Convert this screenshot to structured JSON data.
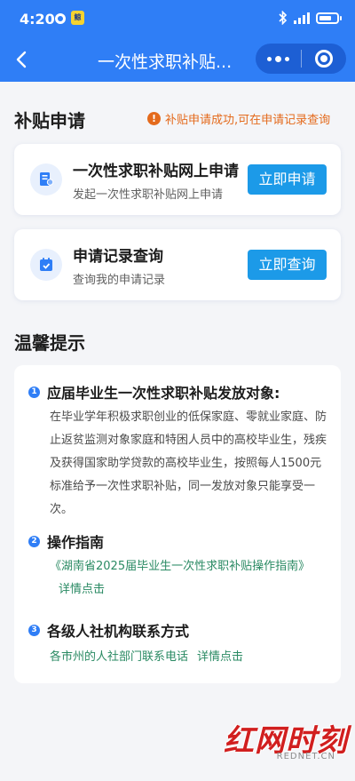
{
  "status_bar": {
    "time": "4:20",
    "app_badge": "鲸鱼"
  },
  "nav": {
    "title": "一次性求职补贴..."
  },
  "apply_section": {
    "title": "补贴申请",
    "notice": "补贴申请成功,可在申请记录查询"
  },
  "cards": [
    {
      "title": "一次性求职补贴网上申请",
      "subtitle": "发起一次性求职补贴网上申请",
      "button": "立即申请"
    },
    {
      "title": "申请记录查询",
      "subtitle": "查询我的申请记录",
      "button": "立即查询"
    }
  ],
  "tips": {
    "title": "温馨提示",
    "items": [
      {
        "num": "1",
        "title": "应届毕业生一次性求职补贴发放对象:",
        "body": "在毕业学年积极求职创业的低保家庭、零就业家庭、防止返贫监测对象家庭和特困人员中的高校毕业生，残疾及获得国家助学贷款的高校毕业生，按照每人1500元标准给予一次性求职补贴，同一发放对象只能享受一次。"
      },
      {
        "num": "2",
        "title": "操作指南",
        "link": "《湖南省2025届毕业生一次性求职补贴操作指南》",
        "more": "详情点击"
      },
      {
        "num": "3",
        "title": "各级人社机构联系方式",
        "link": "各市州的人社部门联系电话",
        "more": "详情点击"
      }
    ]
  },
  "watermark": {
    "text": "红网时刻",
    "sub": "REDNET.CN"
  },
  "colors": {
    "primary": "#2f7ef6",
    "button": "#1c9ae8",
    "notice": "#e46a1c",
    "link": "#2a8a63",
    "watermark": "#d11f1f"
  },
  "icons": [
    "back-icon",
    "more-icon",
    "close-circle-icon",
    "warning-icon",
    "form-icon",
    "calendar-icon"
  ]
}
